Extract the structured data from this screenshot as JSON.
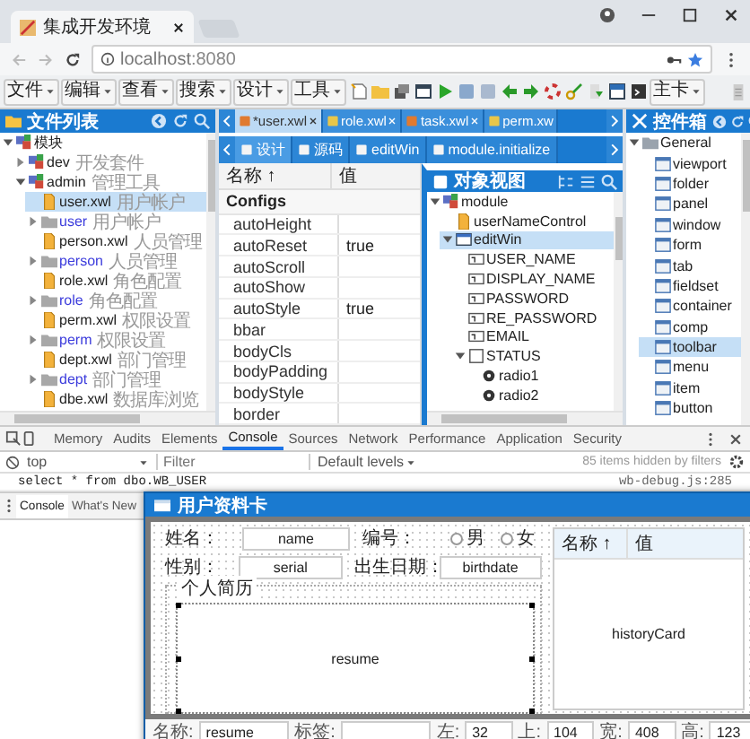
{
  "browser": {
    "tab_title": "集成开发环境",
    "url_host": "localhost",
    "url_port": ":8080"
  },
  "menu": [
    "文件",
    "编辑",
    "查看",
    "搜索",
    "设计",
    "工具"
  ],
  "menu_right": "主卡",
  "file_panel": {
    "title": "文件列表",
    "tree": [
      {
        "label": "模块",
        "kind": "module",
        "expanded": true,
        "selected": false,
        "children": [
          {
            "label": "dev",
            "note": "开发套件",
            "kind": "module",
            "expanded": false,
            "selected": false
          },
          {
            "label": "admin",
            "note": "管理工具",
            "kind": "module",
            "expanded": true,
            "selected": false,
            "children": [
              {
                "label": "user.xwl",
                "note": "用户帐户",
                "kind": "file",
                "selected": true
              },
              {
                "label": "user",
                "note": "用户帐户",
                "kind": "folder",
                "expanded": false,
                "selected": false
              },
              {
                "label": "person.xwl",
                "note": "人员管理",
                "kind": "file",
                "selected": false
              },
              {
                "label": "person",
                "note": "人员管理",
                "kind": "folder",
                "expanded": false,
                "selected": false
              },
              {
                "label": "role.xwl",
                "note": "角色配置",
                "kind": "file",
                "selected": false
              },
              {
                "label": "role",
                "note": "角色配置",
                "kind": "folder",
                "expanded": false,
                "selected": false
              },
              {
                "label": "perm.xwl",
                "note": "权限设置",
                "kind": "file",
                "selected": false
              },
              {
                "label": "perm",
                "note": "权限设置",
                "kind": "folder",
                "expanded": false,
                "selected": false
              },
              {
                "label": "dept.xwl",
                "note": "部门管理",
                "kind": "file",
                "selected": false
              },
              {
                "label": "dept",
                "note": "部门管理",
                "kind": "folder",
                "expanded": false,
                "selected": false
              },
              {
                "label": "dbe.xwl",
                "note": "数据库浏览",
                "kind": "file",
                "selected": false
              }
            ]
          }
        ]
      }
    ]
  },
  "editor_tabs": [
    {
      "label": "*user.xwl",
      "selected": true
    },
    {
      "label": "role.xwl",
      "selected": false
    },
    {
      "label": "task.xwl",
      "selected": false
    },
    {
      "label": "perm.xw",
      "selected": false
    }
  ],
  "sub_tabs": [
    {
      "label": "设计",
      "selected": true
    },
    {
      "label": "源码",
      "selected": false
    },
    {
      "label": "editWin",
      "selected": false
    },
    {
      "label": "module.initialize",
      "selected": false
    }
  ],
  "properties": {
    "columns": [
      "名称 ↑",
      "值"
    ],
    "group": "Configs",
    "rows": [
      {
        "name": "autoHeight"
      },
      {
        "name": "autoReset",
        "value": "true"
      },
      {
        "name": "autoScroll"
      },
      {
        "name": "autoShow"
      },
      {
        "name": "autoStyle",
        "value": "true"
      },
      {
        "name": "bbar"
      },
      {
        "name": "bodyCls"
      },
      {
        "name": "bodyPadding"
      },
      {
        "name": "bodyStyle"
      },
      {
        "name": "border"
      }
    ]
  },
  "object_view": {
    "title": "对象视图",
    "tree": [
      {
        "label": "module",
        "kind": "module",
        "expanded": true,
        "selected": false,
        "children": [
          {
            "label": "userNameControl",
            "kind": "file",
            "selected": false
          },
          {
            "label": "editWin",
            "kind": "window",
            "expanded": true,
            "selected": true,
            "children": [
              {
                "label": "USER_NAME",
                "kind": "field",
                "selected": false
              },
              {
                "label": "DISPLAY_NAME",
                "kind": "field",
                "selected": false
              },
              {
                "label": "PASSWORD",
                "kind": "field",
                "selected": false
              },
              {
                "label": "RE_PASSWORD",
                "kind": "field",
                "selected": false
              },
              {
                "label": "EMAIL",
                "kind": "field",
                "selected": false
              },
              {
                "label": "STATUS",
                "kind": "group",
                "expanded": true,
                "selected": false,
                "children": [
                  {
                    "label": "radio1",
                    "kind": "radio",
                    "selected": false
                  },
                  {
                    "label": "radio2",
                    "kind": "radio",
                    "selected": false
                  }
                ]
              }
            ]
          }
        ]
      }
    ]
  },
  "toolbox": {
    "title": "控件箱",
    "tree": [
      {
        "label": "General",
        "kind": "category",
        "expanded": true,
        "selected": false,
        "children": [
          {
            "label": "viewport",
            "kind": "component",
            "selected": false
          },
          {
            "label": "folder",
            "kind": "component",
            "selected": false
          },
          {
            "label": "panel",
            "kind": "component",
            "selected": false
          },
          {
            "label": "window",
            "kind": "component",
            "selected": false
          },
          {
            "label": "form",
            "kind": "component",
            "selected": false
          },
          {
            "label": "tab",
            "kind": "component",
            "selected": false
          },
          {
            "label": "fieldset",
            "kind": "component",
            "selected": false
          },
          {
            "label": "container",
            "kind": "component",
            "selected": false
          },
          {
            "label": "comp",
            "kind": "component",
            "selected": false
          },
          {
            "label": "toolbar",
            "kind": "component",
            "selected": true
          },
          {
            "label": "menu",
            "kind": "component",
            "selected": false
          },
          {
            "label": "item",
            "kind": "component",
            "selected": false
          },
          {
            "label": "button",
            "kind": "component",
            "selected": false
          }
        ]
      }
    ]
  },
  "devtools": {
    "tabs": [
      {
        "label": "Memory",
        "selected": false
      },
      {
        "label": "Audits",
        "selected": false
      },
      {
        "label": "Elements",
        "selected": false
      },
      {
        "label": "Console",
        "selected": true
      },
      {
        "label": "Sources",
        "selected": false
      },
      {
        "label": "Network",
        "selected": false
      },
      {
        "label": "Performance",
        "selected": false
      },
      {
        "label": "Application",
        "selected": false
      },
      {
        "label": "Security",
        "selected": false
      }
    ],
    "context": "top",
    "filter_placeholder": "Filter",
    "levels": "Default levels",
    "hidden_note": "85 items hidden by filters",
    "console_lines": [
      {
        "text": "select * from dbo.WB_USER",
        "source": "wb-debug.js:285"
      }
    ],
    "drawer_tabs": [
      {
        "label": "Console",
        "selected": true
      },
      {
        "label": "What's New",
        "selected": false
      }
    ]
  },
  "designer": {
    "title": "用户资料卡",
    "name_label": "姓名：",
    "name_value": "name",
    "number_label": "编号：",
    "radios": [
      {
        "label": "男",
        "checked": false
      },
      {
        "label": "女",
        "checked": false
      }
    ],
    "sex_label": "性别：",
    "sex_value": "serial",
    "birth_label": "出生日期：",
    "birth_value": "birthdate",
    "fieldset": "个人简历",
    "resume": {
      "label": "resume",
      "selected": true
    },
    "grid_columns": [
      "名称 ↑",
      "值"
    ],
    "grid_label": "historyCard",
    "props": [
      {
        "label": "名称:",
        "value": "resume"
      },
      {
        "label": "标签:"
      },
      {
        "label": "左:",
        "value": "32"
      },
      {
        "label": "上:",
        "value": "104"
      },
      {
        "label": "宽:",
        "value": "408"
      },
      {
        "label": "高:",
        "value": "123"
      }
    ]
  }
}
